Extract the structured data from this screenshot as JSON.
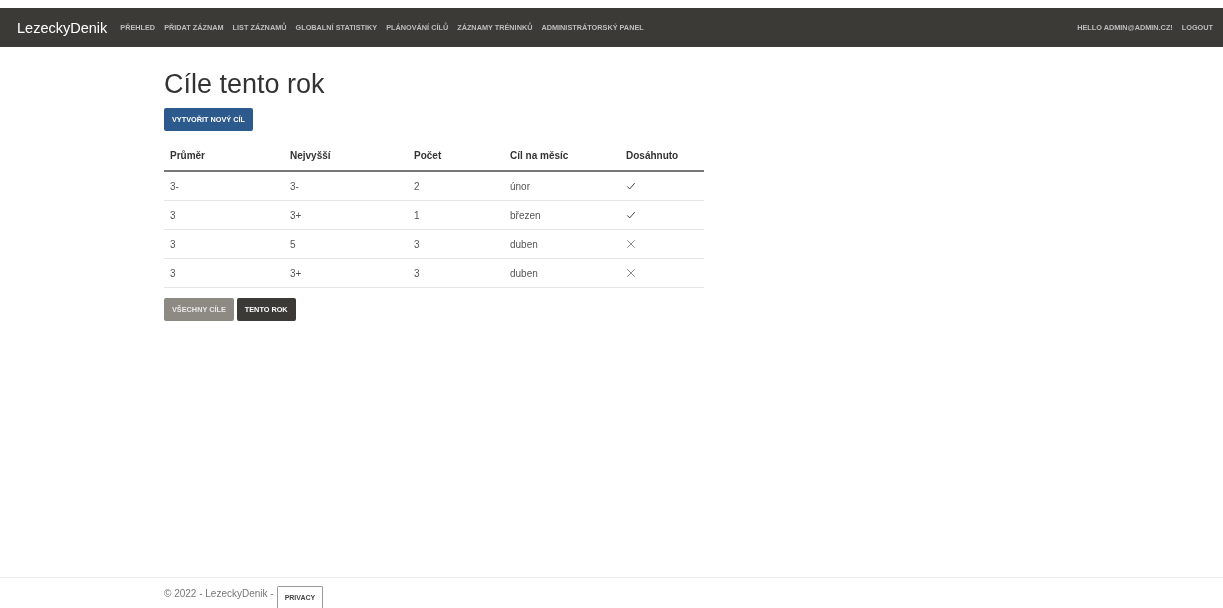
{
  "navbar": {
    "brand": "LezeckyDenik",
    "links": [
      "PŘEHLED",
      "PŘIDAT ZÁZNAM",
      "LIST ZÁZNAMŮ",
      "GLOBALNÍ STATISTIKY",
      "PLÁNOVÁNÍ CÍLŮ",
      "ZÁZNAMY TRÉNINKŮ",
      "ADMINISTRÁTORSKÝ PANEL"
    ],
    "user": "HELLO ADMIN@ADMIN.CZ!",
    "logout": "LOGOUT"
  },
  "title": "Cíle tento rok",
  "create_button": "VYTVOŘIT NOVÝ CÍL",
  "table": {
    "columns": [
      "Průměr",
      "Nejvyšší",
      "Počet",
      "Cíl na měsíc",
      "Dosáhnuto"
    ],
    "rows": [
      {
        "cells": [
          "3-",
          "3-",
          "2",
          "únor"
        ],
        "achieved": true
      },
      {
        "cells": [
          "3",
          "3+",
          "1",
          "březen"
        ],
        "achieved": true
      },
      {
        "cells": [
          "3",
          "5",
          "3",
          "duben"
        ],
        "achieved": false
      },
      {
        "cells": [
          "3",
          "3+",
          "3",
          "duben"
        ],
        "achieved": false
      }
    ]
  },
  "filters": [
    {
      "label": "VŠECHNY CÍLE",
      "selected": false
    },
    {
      "label": "TENTO ROK",
      "selected": true
    }
  ],
  "footer": {
    "text": "© 2022 - LezeckyDenik -",
    "privacy": "PRIVACY"
  }
}
